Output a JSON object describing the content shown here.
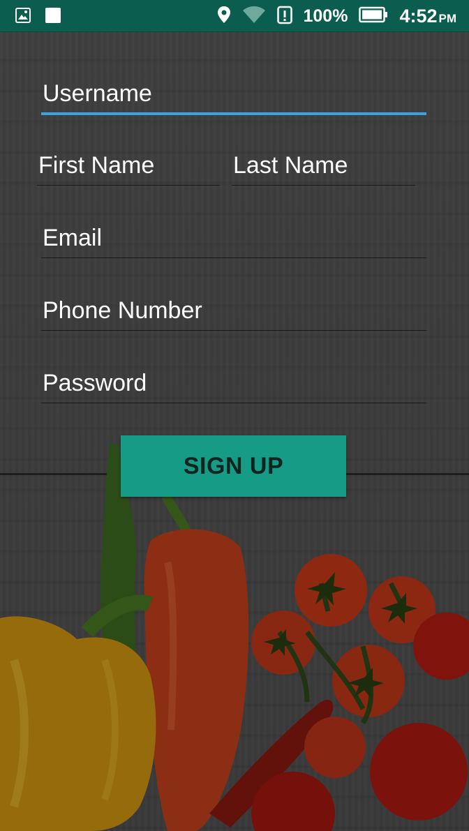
{
  "status_bar": {
    "left_icons": [
      "image-notification-icon",
      "square-notification-icon"
    ],
    "right_icons": [
      "location-icon",
      "wifi-icon",
      "alert-icon"
    ],
    "battery_percent": "100%",
    "time": "4:52",
    "ampm": "PM"
  },
  "form": {
    "username_placeholder": "Username",
    "first_name_placeholder": "First Name",
    "last_name_placeholder": "Last Name",
    "email_placeholder": "Email",
    "phone_placeholder": "Phone Number",
    "password_placeholder": "Password",
    "signup_label": "SIGN UP"
  },
  "colors": {
    "status_bar": "#0b5e4f",
    "accent_underline": "#3aa3e3",
    "button": "#159b86"
  }
}
